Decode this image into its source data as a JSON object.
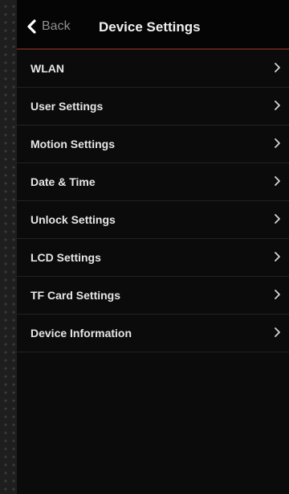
{
  "header": {
    "back_label": "Back",
    "back_icon": "chevron-left-icon",
    "title": "Device Settings"
  },
  "menu": {
    "items": [
      {
        "label": "WLAN",
        "icon": "chevron-right-icon"
      },
      {
        "label": "User Settings",
        "icon": "chevron-right-icon"
      },
      {
        "label": "Motion Settings",
        "icon": "chevron-right-icon"
      },
      {
        "label": "Date & Time",
        "icon": "chevron-right-icon"
      },
      {
        "label": "Unlock Settings",
        "icon": "chevron-right-icon"
      },
      {
        "label": "LCD Settings",
        "icon": "chevron-right-icon"
      },
      {
        "label": "TF Card Settings",
        "icon": "chevron-right-icon"
      },
      {
        "label": "Device Information",
        "icon": "chevron-right-icon"
      }
    ]
  },
  "colors": {
    "background": "#1e1e1e",
    "panel": "#0b0b0b",
    "header_divider": "#5a2218",
    "text": "#e6e6e6",
    "back_text": "#8e8e8e"
  }
}
